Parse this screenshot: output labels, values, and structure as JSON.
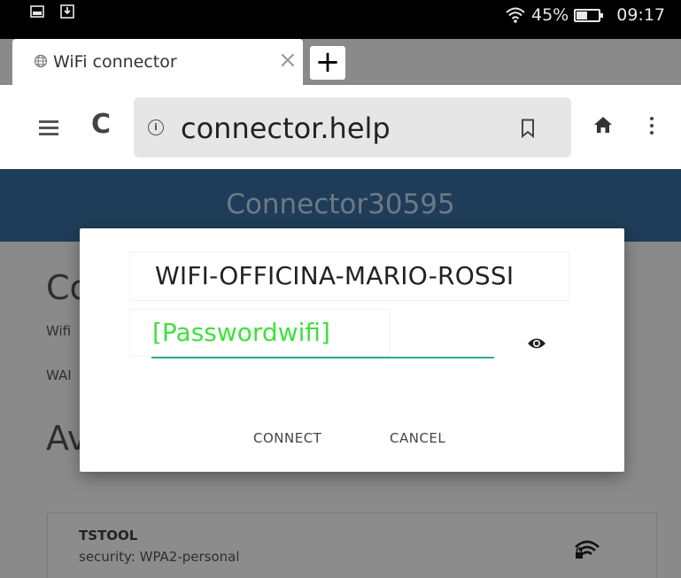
{
  "status_bar": {
    "battery": "45%",
    "time": "09:17"
  },
  "tab": {
    "title": "WiFi connector",
    "close_glyph": "×",
    "new_tab_glyph": "+"
  },
  "toolbar": {
    "reload_glyph": "C",
    "info_glyph": "i",
    "url": "connector.help"
  },
  "page": {
    "title": "Connector30595",
    "heading_connected": "Co",
    "line_wifi": "Wifi",
    "line_wan": "WAI",
    "heading_available": "Av",
    "network": {
      "name": "TSTOOL",
      "security": "security: WPA2-personal"
    }
  },
  "dialog": {
    "ssid": "WIFI-OFFICINA-MARIO-ROSSI",
    "password": "[Passwordwifi]",
    "connect_label": "CONNECT",
    "cancel_label": "CANCEL"
  },
  "colors": {
    "header": "#1f3d58",
    "password_text": "#3fe03f",
    "underline": "#2aa99b"
  }
}
